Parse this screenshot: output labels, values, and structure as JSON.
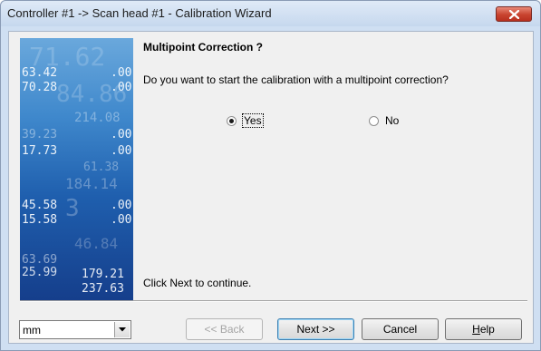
{
  "window": {
    "title": "Controller #1 -> Scan head #1 - Calibration Wizard"
  },
  "wizard": {
    "heading": "Multipoint Correction ?",
    "question": "Do you want to start the calibration with a multipoint correction?",
    "options": [
      {
        "label": "Yes",
        "selected": true
      },
      {
        "label": "No",
        "selected": false
      }
    ],
    "hint": "Click Next to continue."
  },
  "side_image": {
    "numbers": [
      "71.62",
      "63.42",
      ".00",
      "70.28",
      "84.86",
      ".00",
      "214.08",
      "39.23",
      ".00",
      "17.73",
      ".00",
      "61.38",
      "184.14",
      "45.58",
      "3",
      ".00",
      "15.58",
      ".00",
      "46.84",
      "63.69",
      "25.99",
      "179.21",
      "237.63"
    ]
  },
  "footer": {
    "unit_value": "mm",
    "back_label": "<< Back",
    "next_label": "Next >>",
    "cancel_label": "Cancel",
    "help_label_prefix": "",
    "help_label_underlined": "H",
    "help_label_rest": "elp"
  }
}
